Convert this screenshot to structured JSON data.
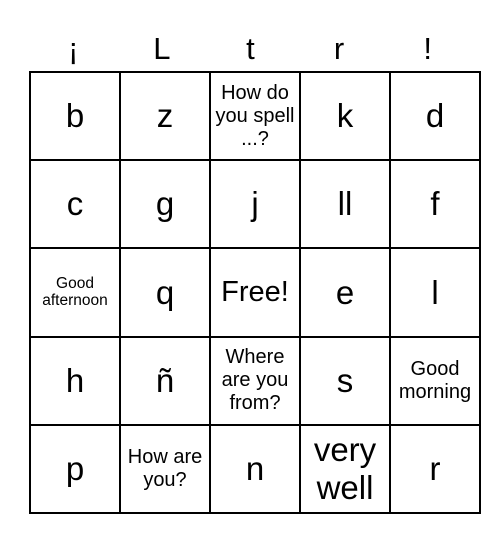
{
  "header": [
    "¡",
    "L",
    "t",
    "r",
    "!"
  ],
  "rows": [
    [
      {
        "text": "b",
        "size": "big"
      },
      {
        "text": "z",
        "size": "big"
      },
      {
        "text": "How do you spell ...?",
        "size": "med"
      },
      {
        "text": "k",
        "size": "big"
      },
      {
        "text": "d",
        "size": "big"
      }
    ],
    [
      {
        "text": "c",
        "size": "big"
      },
      {
        "text": "g",
        "size": "big"
      },
      {
        "text": "j",
        "size": "big"
      },
      {
        "text": "ll",
        "size": "big"
      },
      {
        "text": "f",
        "size": "big"
      }
    ],
    [
      {
        "text": "Good afternoon",
        "size": "small"
      },
      {
        "text": "q",
        "size": "big"
      },
      {
        "text": "Free!",
        "size": "free"
      },
      {
        "text": "e",
        "size": "big"
      },
      {
        "text": "l",
        "size": "big"
      }
    ],
    [
      {
        "text": "h",
        "size": "big"
      },
      {
        "text": "ñ",
        "size": "big"
      },
      {
        "text": "Where are you from?",
        "size": "med"
      },
      {
        "text": "s",
        "size": "big"
      },
      {
        "text": "Good morning",
        "size": "med"
      }
    ],
    [
      {
        "text": "p",
        "size": "big"
      },
      {
        "text": "How are you?",
        "size": "med"
      },
      {
        "text": "n",
        "size": "big"
      },
      {
        "text": "very well",
        "size": "vw"
      },
      {
        "text": "r",
        "size": "big"
      }
    ]
  ]
}
